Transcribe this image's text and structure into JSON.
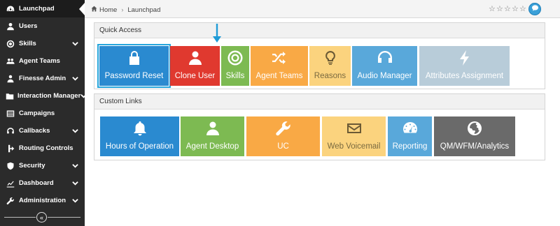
{
  "sidebar": {
    "items": [
      {
        "label": "Launchpad",
        "icon": "dashboard-gauge-icon",
        "has_chevron": false,
        "active": true
      },
      {
        "label": "Users",
        "icon": "user-icon",
        "has_chevron": false
      },
      {
        "label": "Skills",
        "icon": "target-icon",
        "has_chevron": true
      },
      {
        "label": "Agent Teams",
        "icon": "team-icon",
        "has_chevron": false
      },
      {
        "label": "Finesse Admin",
        "icon": "person-tie-icon",
        "has_chevron": true
      },
      {
        "label": "Interaction Manager",
        "icon": "folder-icon",
        "has_chevron": true
      },
      {
        "label": "Campaigns",
        "icon": "list-icon",
        "has_chevron": false
      },
      {
        "label": "Callbacks",
        "icon": "headset-icon",
        "has_chevron": true
      },
      {
        "label": "Routing Controls",
        "icon": "routing-icon",
        "has_chevron": false
      },
      {
        "label": "Security",
        "icon": "shield-icon",
        "has_chevron": true
      },
      {
        "label": "Dashboard",
        "icon": "chart-icon",
        "has_chevron": true
      },
      {
        "label": "Administration",
        "icon": "wrench-icon",
        "has_chevron": true
      }
    ],
    "collapse_glyph": "«"
  },
  "breadcrumb": {
    "home": "Home",
    "separator": "›",
    "current": "Launchpad"
  },
  "rating": {
    "stars": [
      "☆",
      "☆",
      "☆",
      "☆",
      "☆"
    ]
  },
  "quick_access": {
    "title": "Quick Access",
    "tiles": [
      {
        "label": "Password Reset",
        "icon": "lock-icon",
        "color": "#2a8ad0",
        "selected": true
      },
      {
        "label": "Clone User",
        "icon": "user-icon",
        "color": "#e0392f"
      },
      {
        "label": "Skills",
        "icon": "target-icon",
        "color": "#7dba52"
      },
      {
        "label": "Agent Teams",
        "icon": "shuffle-icon",
        "color": "#f9a945"
      },
      {
        "label": "Reasons",
        "icon": "lightbulb-icon",
        "color": "#fbd37e",
        "text_color": "#7a6a40"
      },
      {
        "label": "Audio Manager",
        "icon": "headphones-icon",
        "color": "#59a8da"
      },
      {
        "label": "Attributes Assignment",
        "icon": "bolt-icon",
        "color": "#b8ccd9"
      }
    ]
  },
  "custom_links": {
    "title": "Custom Links",
    "tiles": [
      {
        "label": "Hours of Operation",
        "icon": "bell-icon",
        "color": "#2a8ad0"
      },
      {
        "label": "Agent Desktop",
        "icon": "user-icon",
        "color": "#7dba52"
      },
      {
        "label": "UC",
        "icon": "wrench-icon",
        "color": "#f9a945"
      },
      {
        "label": "Web Voicemail",
        "icon": "envelope-icon",
        "color": "#fbd37e",
        "text_color": "#7a6a40"
      },
      {
        "label": "Reporting",
        "icon": "gauge-icon",
        "color": "#59a8da"
      },
      {
        "label": "QM/WFM/Analytics",
        "icon": "globe-icon",
        "color": "#6a6a6a"
      }
    ]
  }
}
